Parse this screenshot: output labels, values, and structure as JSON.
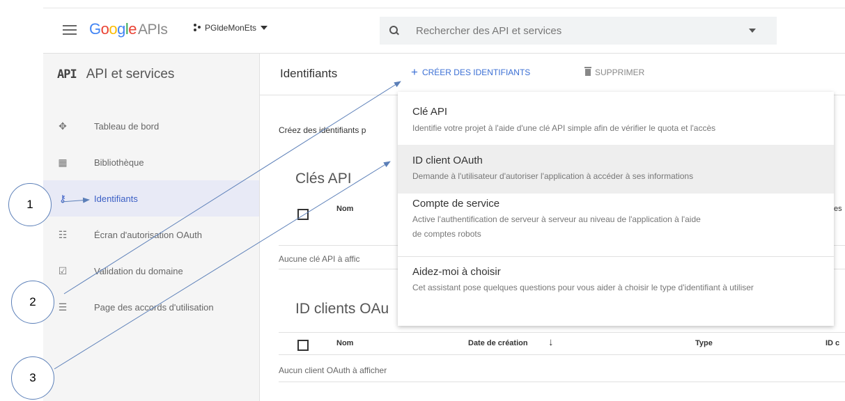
{
  "header": {
    "logo": {
      "google": "Google",
      "apis": "APIs"
    },
    "project": "PGldeMonEts",
    "search_placeholder": "Rechercher des API et services"
  },
  "sidebar": {
    "badge": "API",
    "title": "API et services",
    "items": [
      {
        "label": "Tableau de bord",
        "icon": "dashboard-icon",
        "active": false
      },
      {
        "label": "Bibliothèque",
        "icon": "library-icon",
        "active": false
      },
      {
        "label": "Identifiants",
        "icon": "key-icon",
        "active": true
      },
      {
        "label": "Écran d'autorisation OAuth",
        "icon": "consent-screen-icon",
        "active": false
      },
      {
        "label": "Validation du domaine",
        "icon": "domain-verification-icon",
        "active": false
      },
      {
        "label": "Page des accords d'utilisation",
        "icon": "agreements-icon",
        "active": false
      }
    ]
  },
  "toolbar": {
    "page_title": "Identifiants",
    "create_label": "CRÉER DES IDENTIFIANTS",
    "delete_label": "SUPPRIMER"
  },
  "content": {
    "intro": "Créez des identifiants p",
    "api_keys": {
      "title": "Clés API",
      "col_name": "Nom",
      "col_right": "es",
      "empty": "Aucune clé API à affic"
    },
    "oauth_clients": {
      "title": "ID clients OAu",
      "columns": [
        "Nom",
        "Date de création",
        "Type",
        "ID c"
      ],
      "sort_indicator": "↓",
      "empty": "Aucun client OAuth à afficher"
    }
  },
  "menu": {
    "items": [
      {
        "title": "Clé API",
        "desc": "Identifie votre projet à l'aide d'une clé API simple afin de vérifier le quota et l'accès"
      },
      {
        "title": "ID client OAuth",
        "desc": "Demande à l'utilisateur d'autoriser l'application à accéder à ses informations"
      },
      {
        "title": "Compte de service",
        "desc": "Active l'authentification de serveur à serveur au niveau de l'application à l'aide de comptes robots"
      },
      {
        "title": "Aidez-moi à choisir",
        "desc": "Cet assistant pose quelques questions pour vous aider à choisir le type d'identifiant à utiliser"
      }
    ]
  },
  "annotations": {
    "labels": [
      "1",
      "2",
      "3"
    ],
    "color": "#5b7fb8"
  },
  "colors": {
    "accent": "#3b6fd4",
    "active_bg": "#e8eaf6",
    "sidebar_bg": "#f5f5f5"
  }
}
